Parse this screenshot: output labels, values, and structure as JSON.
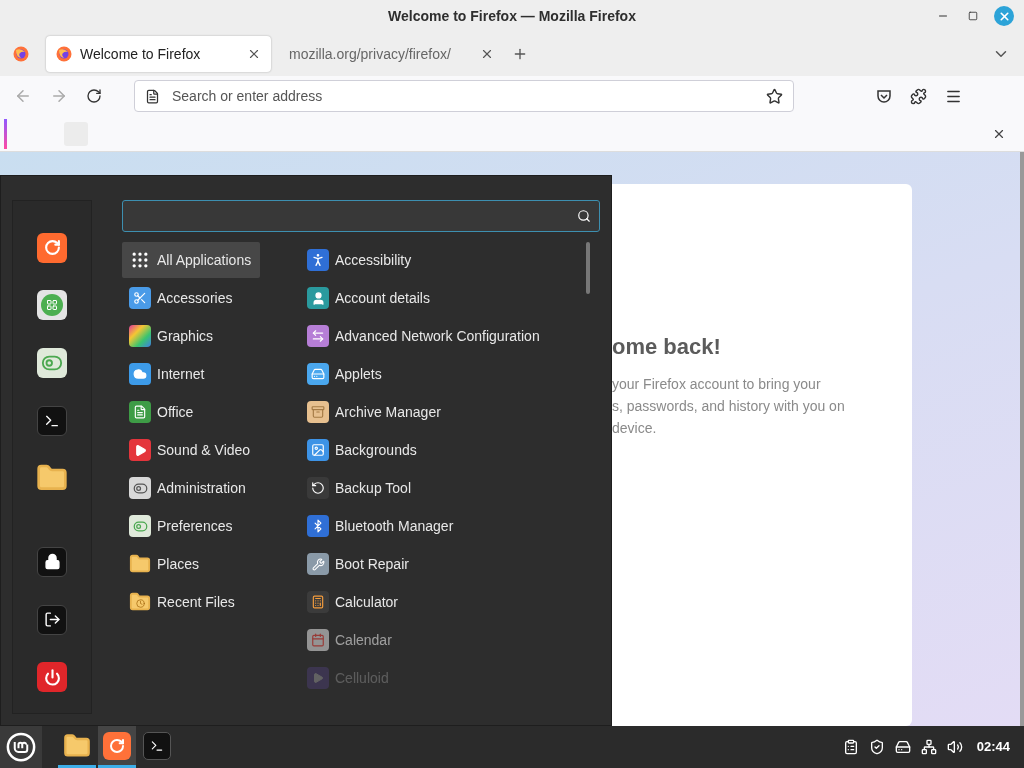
{
  "window": {
    "title": "Welcome to Firefox — Mozilla Firefox"
  },
  "tabs": [
    {
      "label": "Welcome to Firefox",
      "selected": true
    },
    {
      "label": "mozilla.org/privacy/firefox/",
      "selected": false
    }
  ],
  "address_bar": {
    "placeholder": "Search or enter address"
  },
  "page": {
    "heading": "ome back!",
    "body_lines": [
      "your Firefox account to bring your",
      "s, passwords, and history with you on",
      "device."
    ]
  },
  "menu": {
    "categories": [
      {
        "label": "All Applications",
        "selected": true
      },
      {
        "label": "Accessories",
        "selected": false
      },
      {
        "label": "Graphics",
        "selected": false
      },
      {
        "label": "Internet",
        "selected": false
      },
      {
        "label": "Office",
        "selected": false
      },
      {
        "label": "Sound & Video",
        "selected": false
      },
      {
        "label": "Administration",
        "selected": false
      },
      {
        "label": "Preferences",
        "selected": false
      },
      {
        "label": "Places",
        "selected": false
      },
      {
        "label": "Recent Files",
        "selected": false
      }
    ],
    "apps": [
      {
        "label": "Accessibility",
        "dimmed": false
      },
      {
        "label": "Account details",
        "dimmed": false
      },
      {
        "label": "Advanced Network Configuration",
        "dimmed": false
      },
      {
        "label": "Applets",
        "dimmed": false
      },
      {
        "label": "Archive Manager",
        "dimmed": false
      },
      {
        "label": "Backgrounds",
        "dimmed": false
      },
      {
        "label": "Backup Tool",
        "dimmed": false
      },
      {
        "label": "Bluetooth Manager",
        "dimmed": false
      },
      {
        "label": "Boot Repair",
        "dimmed": false
      },
      {
        "label": "Calculator",
        "dimmed": false
      },
      {
        "label": "Calendar",
        "dimmed": true
      },
      {
        "label": "Celluloid",
        "dimmed": true
      }
    ]
  },
  "taskbar": {
    "launchers": [
      {
        "running": true,
        "selected": false
      },
      {
        "running": true,
        "selected": true
      },
      {
        "running": false,
        "selected": false
      }
    ],
    "clock": "02:44"
  }
}
